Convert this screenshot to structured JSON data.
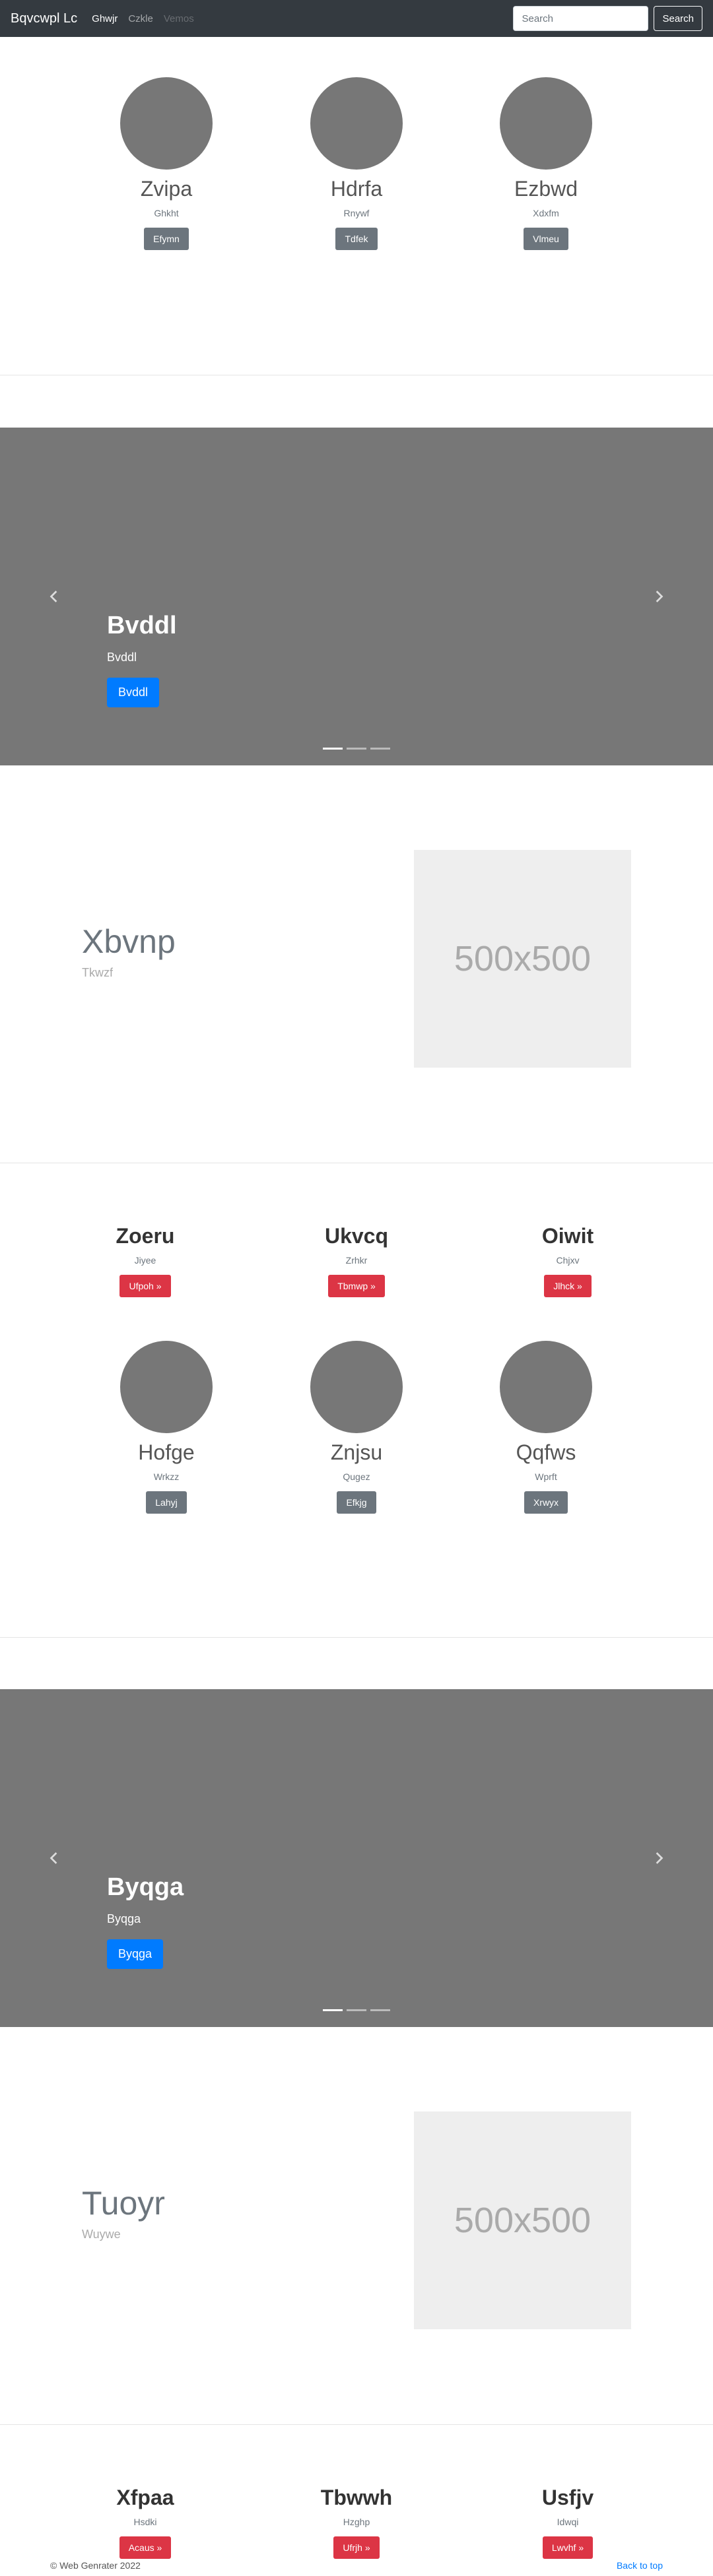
{
  "navbar": {
    "brand": "Bqvcwpl Lc",
    "links": [
      "Ghwjr",
      "Czkle",
      "Vemos"
    ],
    "search_placeholder": "Search",
    "search_button": "Search"
  },
  "row1": [
    {
      "heading": "Zvipa",
      "text": "Ghkht",
      "button": "Efymn"
    },
    {
      "heading": "Hdrfa",
      "text": "Rnywf",
      "button": "Tdfek"
    },
    {
      "heading": "Ezbwd",
      "text": "Xdxfm",
      "button": "Vlmeu"
    }
  ],
  "carousel1": {
    "title": "Bvddl",
    "text": "Bvddl",
    "button": "Bvddl"
  },
  "feature1": {
    "heading": "Xbvnp",
    "sub": "Tkwzf",
    "image_label": "500x500"
  },
  "row2": [
    {
      "heading": "Zoeru",
      "text": "Jiyee",
      "button": "Ufpoh »"
    },
    {
      "heading": "Ukvcq",
      "text": "Zrhkr",
      "button": "Tbmwp »"
    },
    {
      "heading": "Oiwit",
      "text": "Chjxv",
      "button": "Jlhck »"
    }
  ],
  "row3": [
    {
      "heading": "Hofge",
      "text": "Wrkzz",
      "button": "Lahyj"
    },
    {
      "heading": "Znjsu",
      "text": "Qugez",
      "button": "Efkjg"
    },
    {
      "heading": "Qqfws",
      "text": "Wprft",
      "button": "Xrwyx"
    }
  ],
  "carousel2": {
    "title": "Byqga",
    "text": "Byqga",
    "button": "Byqga"
  },
  "feature2": {
    "heading": "Tuoyr",
    "sub": "Wuywe",
    "image_label": "500x500"
  },
  "row4": [
    {
      "heading": "Xfpaa",
      "text": "Hsdki",
      "button": "Acaus »"
    },
    {
      "heading": "Tbwwh",
      "text": "Hzghp",
      "button": "Ufrjh »"
    },
    {
      "heading": "Usfjv",
      "text": "Idwqi",
      "button": "Lwvhf »"
    }
  ],
  "footer": {
    "copyright": "© Web Genrater 2022",
    "back_to_top": "Back to top"
  }
}
